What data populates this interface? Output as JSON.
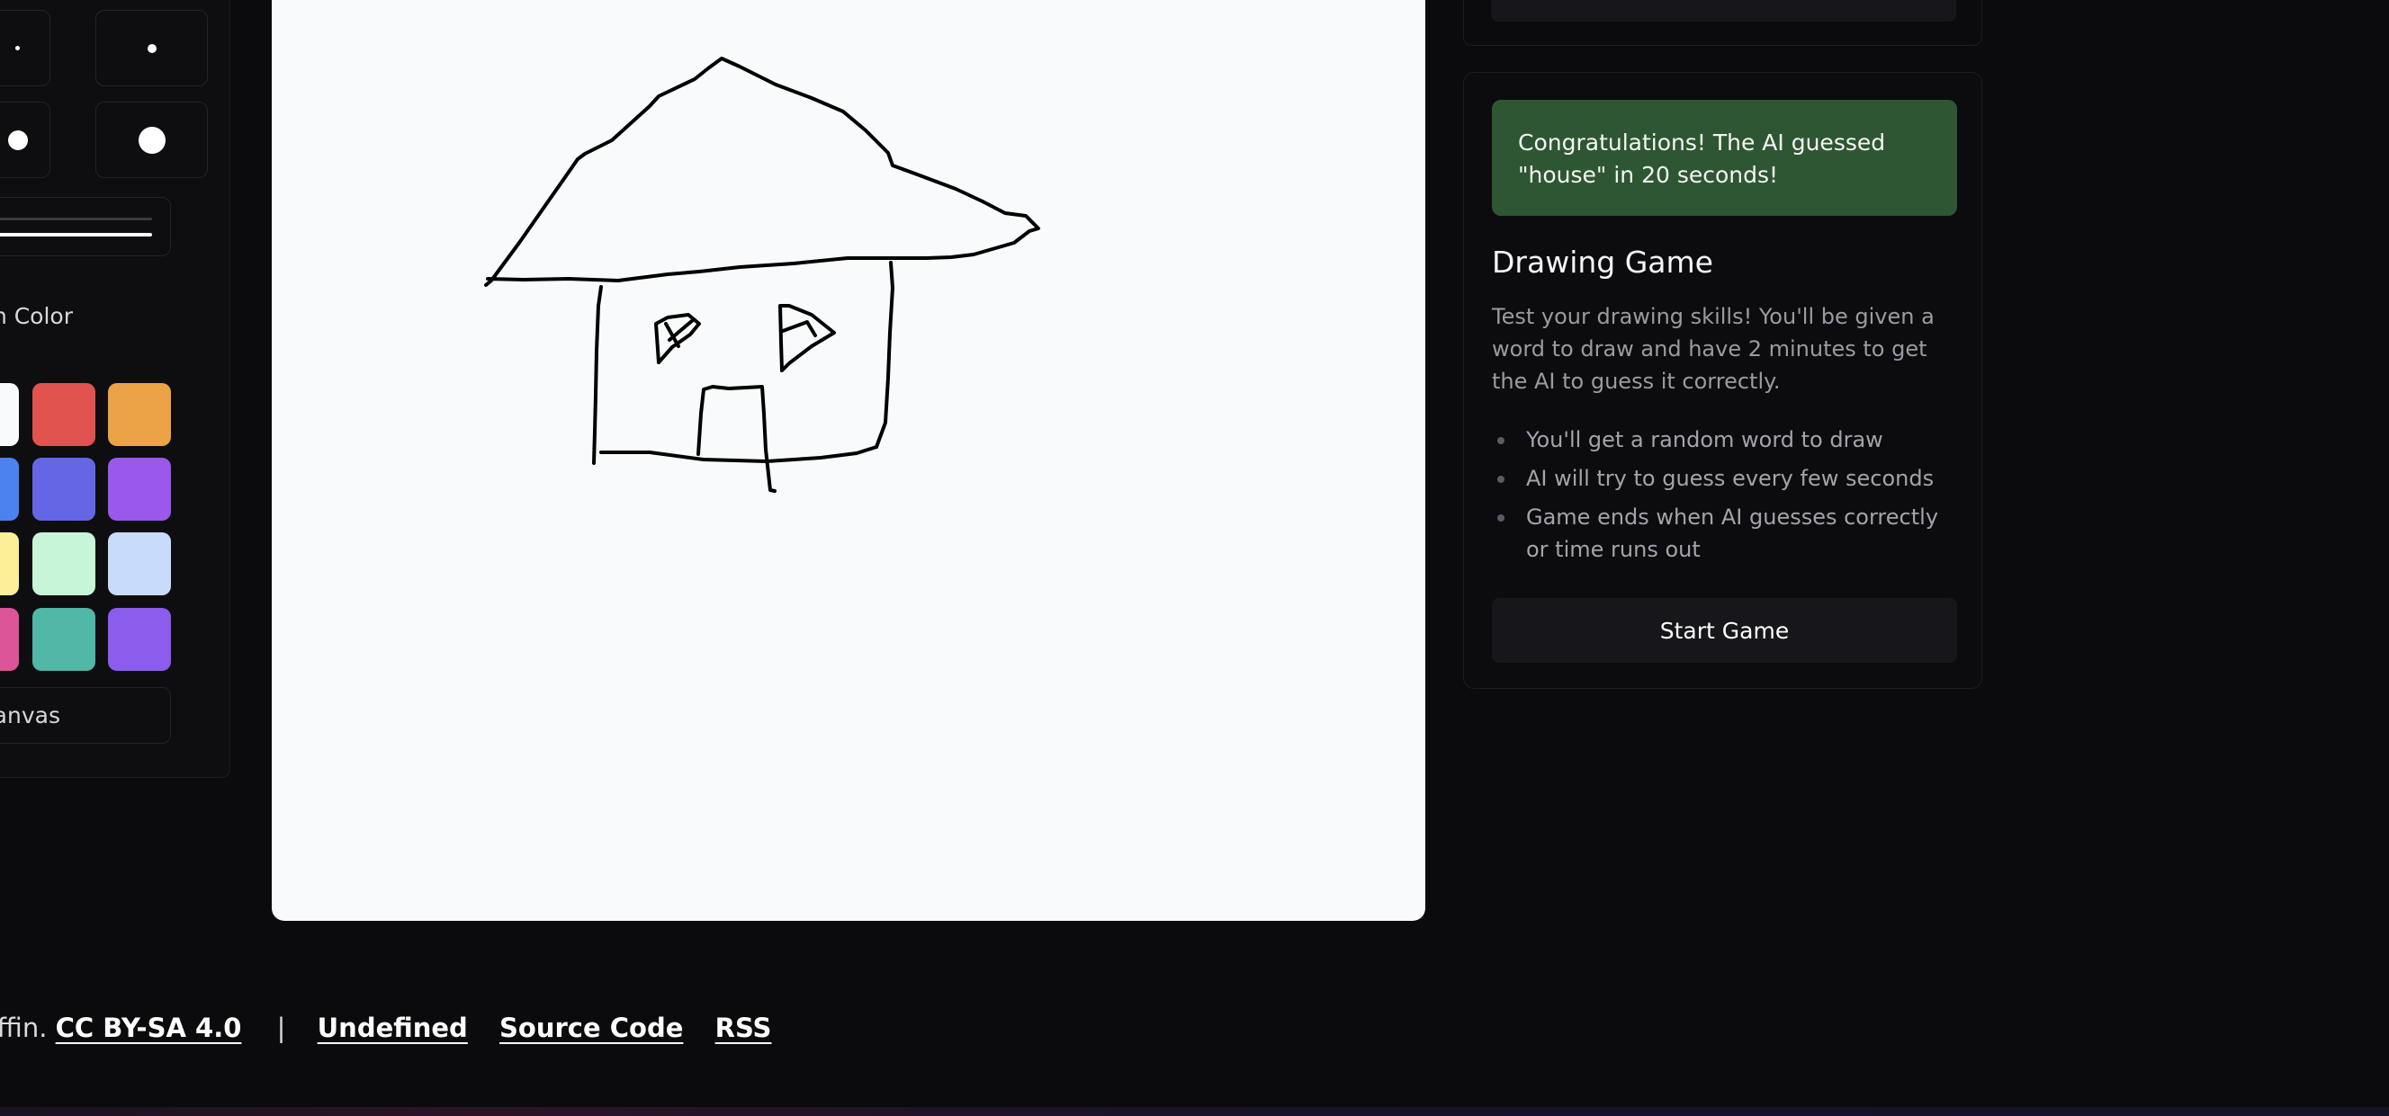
{
  "tool_panel": {
    "pen_sizes": [
      "xs",
      "sm",
      "md",
      "lg"
    ],
    "pen_color_label": "n Color",
    "palette": [
      "#f8fafc",
      "#e0534e",
      "#eba345",
      "#4b82ef",
      "#6566e6",
      "#9b58ec",
      "#fcef97",
      "#c6f6d7",
      "#c9dbfa",
      "#dc5599",
      "#51b7a6",
      "#8c5cec"
    ],
    "clear_label": "r Canvas"
  },
  "game": {
    "success_message": "Congratulations! The AI guessed \"house\" in 20 seconds!",
    "title": "Drawing Game",
    "description": "Test your drawing skills! You'll be given a word to draw and have 2 minutes to get the AI to guess it correctly.",
    "rules": [
      "You'll get a random word to draw",
      "AI will try to guess every few seconds",
      "Game ends when AI guesses correctly or time runs out"
    ],
    "start_label": "Start Game"
  },
  "footer": {
    "credit_text": "s Griffin.",
    "license_link": "CC BY-SA 4.0",
    "separator": "|",
    "links": [
      "Undefined",
      "Source Code",
      "RSS"
    ]
  },
  "colors": {
    "background": "#0b0b0d",
    "canvas": "#f8fafc",
    "success_banner": "#2e5632",
    "button": "#17171b"
  }
}
